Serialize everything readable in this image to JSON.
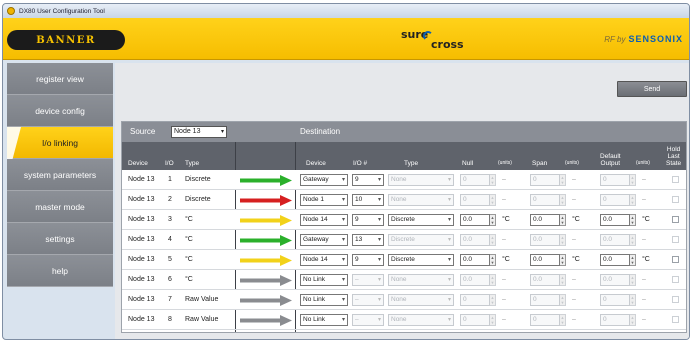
{
  "window": {
    "title": "DX80 User Configuration Tool"
  },
  "banner": {
    "logo": "BANNER",
    "product_top": "sure",
    "product_bottom": "cross",
    "rf_by": "RF by",
    "partner": "SENSONIX"
  },
  "sidebar": {
    "items": [
      {
        "label": "register view",
        "active": false
      },
      {
        "label": "device config",
        "active": false
      },
      {
        "label": "I/o linking",
        "active": true
      },
      {
        "label": "system parameters",
        "active": false
      },
      {
        "label": "master mode",
        "active": false
      },
      {
        "label": "settings",
        "active": false
      },
      {
        "label": "help",
        "active": false
      }
    ]
  },
  "toolbar": {
    "send_label": "Send"
  },
  "source": {
    "label": "Source",
    "value": "Node 13"
  },
  "destination": {
    "label": "Destination"
  },
  "columns": {
    "device": "Device",
    "io": "I/O",
    "type": "Type",
    "dest_device": "Device",
    "io_num": "I/O #",
    "dest_type": "Type",
    "null": "Null",
    "units1": "(units)",
    "span": "Span",
    "units2": "(units)",
    "default_output_1": "Default",
    "default_output_2": "Output",
    "units3": "(units)",
    "hold_1": "Hold",
    "hold_2": "Last",
    "hold_3": "State"
  },
  "colors": {
    "green": "#2bb02b",
    "red": "#d62020",
    "yellow": "#f2d21a",
    "gray": "#8a8c90"
  },
  "rows": [
    {
      "device": "Node 13",
      "io": "1",
      "type": "Discrete",
      "arrow": "green",
      "dest_device": "Gateway",
      "io_num": "9",
      "dest_type": "None",
      "null": "0",
      "null_unit": "–",
      "span": "0",
      "span_unit": "–",
      "default": "0",
      "default_unit": "–",
      "enabled": false
    },
    {
      "device": "Node 13",
      "io": "2",
      "type": "Discrete",
      "arrow": "red",
      "dest_device": "Node 1",
      "io_num": "10",
      "dest_type": "None",
      "null": "0",
      "null_unit": "–",
      "span": "0",
      "span_unit": "–",
      "default": "0",
      "default_unit": "–",
      "enabled": false
    },
    {
      "device": "Node 13",
      "io": "3",
      "type": "°C",
      "arrow": "yellow",
      "dest_device": "Node 14",
      "io_num": "9",
      "dest_type": "Discrete",
      "null": "0.0",
      "null_unit": "°C",
      "span": "0.0",
      "span_unit": "°C",
      "default": "0.0",
      "default_unit": "°C",
      "enabled": true
    },
    {
      "device": "Node 13",
      "io": "4",
      "type": "°C",
      "arrow": "green",
      "dest_device": "Gateway",
      "io_num": "13",
      "dest_type": "Discrete",
      "null": "0.0",
      "null_unit": "–",
      "span": "0.0",
      "span_unit": "–",
      "default": "0.0",
      "default_unit": "–",
      "enabled": false
    },
    {
      "device": "Node 13",
      "io": "5",
      "type": "°C",
      "arrow": "yellow",
      "dest_device": "Node 14",
      "io_num": "9",
      "dest_type": "Discrete",
      "null": "0.0",
      "null_unit": "°C",
      "span": "0.0",
      "span_unit": "°C",
      "default": "0.0",
      "default_unit": "°C",
      "enabled": true
    },
    {
      "device": "Node 13",
      "io": "6",
      "type": "°C",
      "arrow": "gray",
      "dest_device": "No Link",
      "io_num": "–",
      "dest_type": "None",
      "null": "0.0",
      "null_unit": "–",
      "span": "0.0",
      "span_unit": "–",
      "default": "0.0",
      "default_unit": "–",
      "enabled": false
    },
    {
      "device": "Node 13",
      "io": "7",
      "type": "Raw Value",
      "arrow": "gray",
      "dest_device": "No Link",
      "io_num": "–",
      "dest_type": "None",
      "null": "0",
      "null_unit": "–",
      "span": "0",
      "span_unit": "–",
      "default": "0",
      "default_unit": "–",
      "enabled": false
    },
    {
      "device": "Node 13",
      "io": "8",
      "type": "Raw Value",
      "arrow": "gray",
      "dest_device": "No Link",
      "io_num": "–",
      "dest_type": "None",
      "null": "0",
      "null_unit": "–",
      "span": "0",
      "span_unit": "–",
      "default": "0",
      "default_unit": "–",
      "enabled": false
    }
  ]
}
